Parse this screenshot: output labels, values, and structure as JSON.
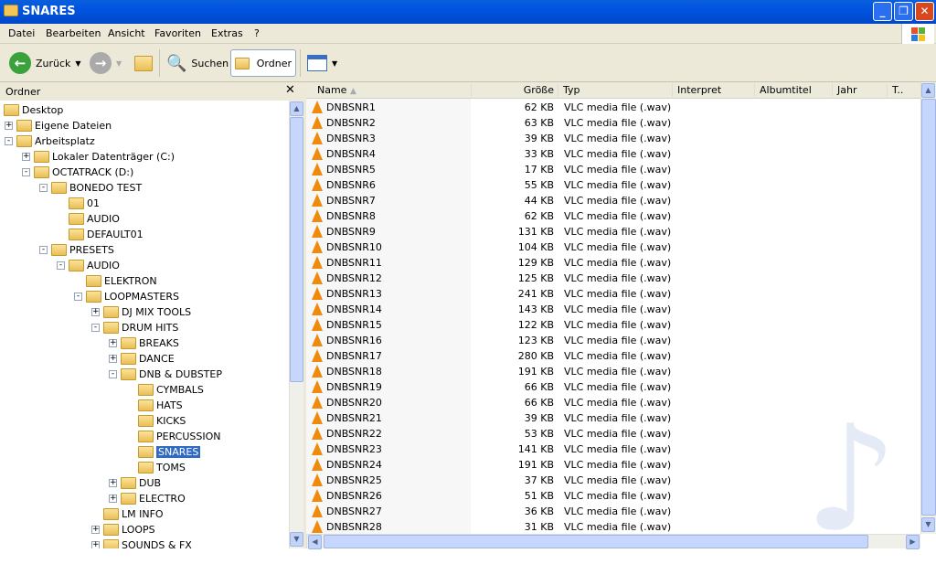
{
  "window": {
    "title": "SNARES",
    "min": "_",
    "max": "❐",
    "close": "✕"
  },
  "menu": [
    "Datei",
    "Bearbeiten",
    "Ansicht",
    "Favoriten",
    "Extras",
    "?"
  ],
  "toolbar": {
    "back": "Zurück",
    "search": "Suchen",
    "folders": "Ordner"
  },
  "folders_pane": {
    "title": "Ordner",
    "close": "✕"
  },
  "tree": [
    {
      "label": "Desktop",
      "level": 0,
      "exp": ""
    },
    {
      "label": "Eigene Dateien",
      "level": 1,
      "exp": "+"
    },
    {
      "label": "Arbeitsplatz",
      "level": 1,
      "exp": "-"
    },
    {
      "label": "Lokaler Datenträger (C:)",
      "level": 2,
      "exp": "+"
    },
    {
      "label": "OCTATRACK (D:)",
      "level": 2,
      "exp": "-"
    },
    {
      "label": "BONEDO TEST",
      "level": 3,
      "exp": "-"
    },
    {
      "label": "01",
      "level": 4,
      "exp": ""
    },
    {
      "label": "AUDIO",
      "level": 4,
      "exp": ""
    },
    {
      "label": "DEFAULT01",
      "level": 4,
      "exp": ""
    },
    {
      "label": "PRESETS",
      "level": 3,
      "exp": "-"
    },
    {
      "label": "AUDIO",
      "level": 4,
      "exp": "-"
    },
    {
      "label": "ELEKTRON",
      "level": 5,
      "exp": ""
    },
    {
      "label": "LOOPMASTERS",
      "level": 5,
      "exp": "-"
    },
    {
      "label": "DJ MIX TOOLS",
      "level": 6,
      "exp": "+"
    },
    {
      "label": "DRUM HITS",
      "level": 6,
      "exp": "-"
    },
    {
      "label": "BREAKS",
      "level": 7,
      "exp": "+"
    },
    {
      "label": "DANCE",
      "level": 7,
      "exp": "+"
    },
    {
      "label": "DNB & DUBSTEP",
      "level": 7,
      "exp": "-"
    },
    {
      "label": "CYMBALS",
      "level": 8,
      "exp": ""
    },
    {
      "label": "HATS",
      "level": 8,
      "exp": ""
    },
    {
      "label": "KICKS",
      "level": 8,
      "exp": ""
    },
    {
      "label": "PERCUSSION",
      "level": 8,
      "exp": ""
    },
    {
      "label": "SNARES",
      "level": 8,
      "exp": "",
      "selected": true
    },
    {
      "label": "TOMS",
      "level": 8,
      "exp": ""
    },
    {
      "label": "DUB",
      "level": 7,
      "exp": "+"
    },
    {
      "label": "ELECTRO",
      "level": 7,
      "exp": "+"
    },
    {
      "label": "LM INFO",
      "level": 6,
      "exp": ""
    },
    {
      "label": "LOOPS",
      "level": 6,
      "exp": "+"
    },
    {
      "label": "SOUNDS & FX",
      "level": 6,
      "exp": "+"
    }
  ],
  "columns": [
    "Name",
    "Größe",
    "Typ",
    "Interpret",
    "Albumtitel",
    "Jahr",
    "T.."
  ],
  "file_type": "VLC media file (.wav)",
  "files": [
    [
      "DNBSNR1",
      "62 KB"
    ],
    [
      "DNBSNR2",
      "63 KB"
    ],
    [
      "DNBSNR3",
      "39 KB"
    ],
    [
      "DNBSNR4",
      "33 KB"
    ],
    [
      "DNBSNR5",
      "17 KB"
    ],
    [
      "DNBSNR6",
      "55 KB"
    ],
    [
      "DNBSNR7",
      "44 KB"
    ],
    [
      "DNBSNR8",
      "62 KB"
    ],
    [
      "DNBSNR9",
      "131 KB"
    ],
    [
      "DNBSNR10",
      "104 KB"
    ],
    [
      "DNBSNR11",
      "129 KB"
    ],
    [
      "DNBSNR12",
      "125 KB"
    ],
    [
      "DNBSNR13",
      "241 KB"
    ],
    [
      "DNBSNR14",
      "143 KB"
    ],
    [
      "DNBSNR15",
      "122 KB"
    ],
    [
      "DNBSNR16",
      "123 KB"
    ],
    [
      "DNBSNR17",
      "280 KB"
    ],
    [
      "DNBSNR18",
      "191 KB"
    ],
    [
      "DNBSNR19",
      "66 KB"
    ],
    [
      "DNBSNR20",
      "66 KB"
    ],
    [
      "DNBSNR21",
      "39 KB"
    ],
    [
      "DNBSNR22",
      "53 KB"
    ],
    [
      "DNBSNR23",
      "141 KB"
    ],
    [
      "DNBSNR24",
      "191 KB"
    ],
    [
      "DNBSNR25",
      "37 KB"
    ],
    [
      "DNBSNR26",
      "51 KB"
    ],
    [
      "DNBSNR27",
      "36 KB"
    ],
    [
      "DNBSNR28",
      "31 KB"
    ]
  ]
}
